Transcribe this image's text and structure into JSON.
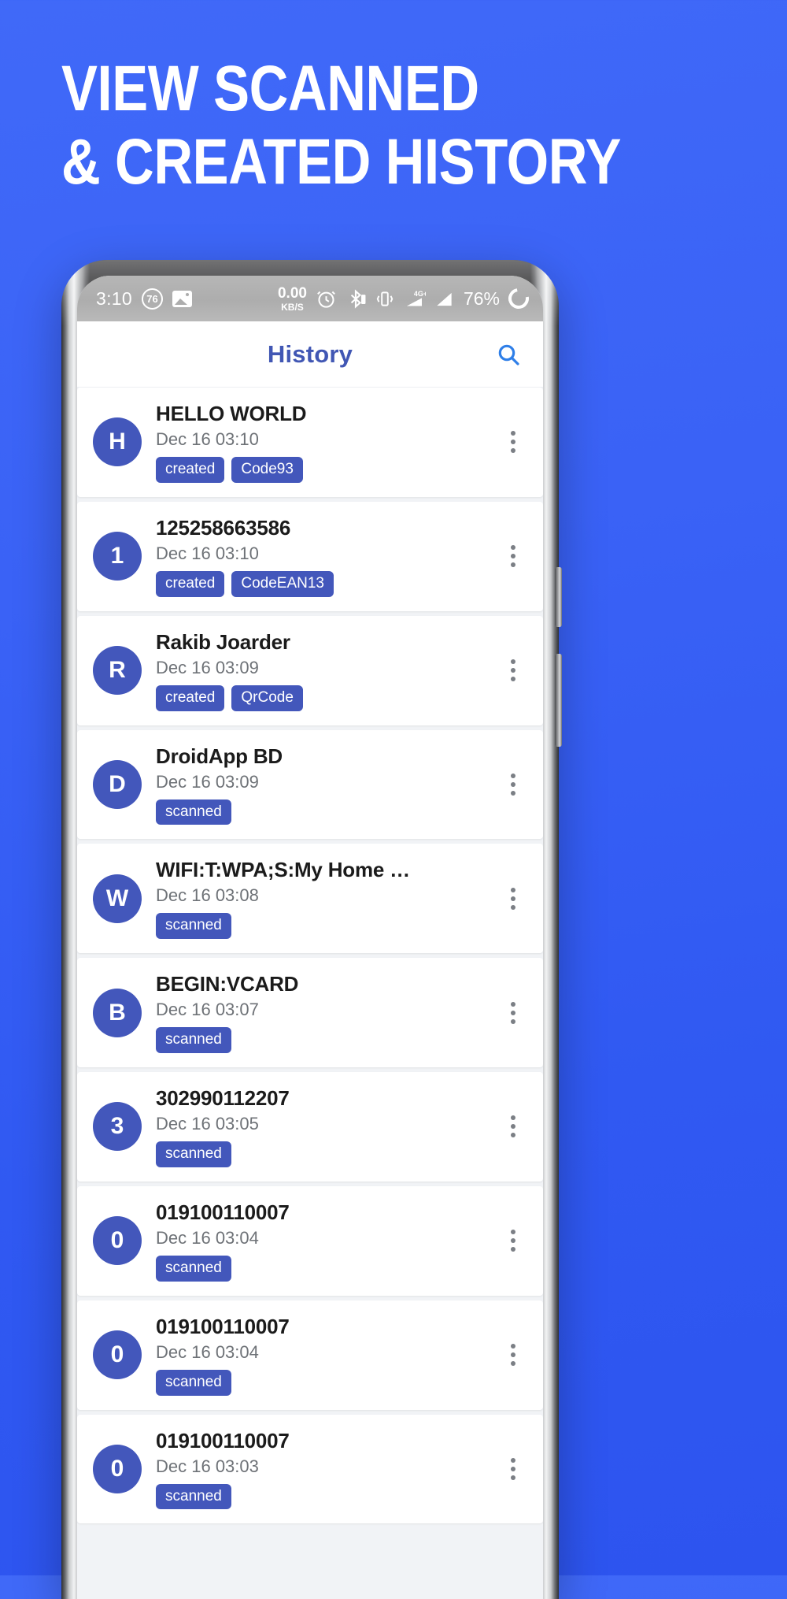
{
  "promo": {
    "line1": "VIEW SCANNED",
    "line2": "& CREATED HISTORY",
    "background_color": "#3a62f6",
    "text_color": "#ffffff"
  },
  "statusbar": {
    "time": "3:10",
    "notification_badge": "76",
    "image_icon": "image-icon",
    "network_speed_value": "0.00",
    "network_speed_unit": "KB/S",
    "alarm_icon": "alarm-clock-icon",
    "bluetooth_icon": "bluetooth-icon",
    "battery_small_icon": "battery-icon",
    "vibrate_icon": "vibrate-icon",
    "network_type": "4G+",
    "signal_icon_1": "signal-bars-icon",
    "signal_icon_2": "signal-bars-icon",
    "battery_percent": "76%",
    "battery_ring_icon": "battery-ring-icon"
  },
  "appbar": {
    "title": "History",
    "title_color": "#4157b4",
    "search_icon": "search-icon",
    "search_icon_color": "#2f7fe8"
  },
  "theme": {
    "accent": "#4357bb",
    "chip_bg": "#4357bb",
    "card_bg": "#ffffff",
    "list_bg": "#f1f3f6",
    "title_color": "#1b1b1b",
    "time_color": "#6e7277"
  },
  "list": {
    "items": [
      {
        "avatar": "H",
        "title": "HELLO WORLD",
        "time": "Dec 16 03:10",
        "chips": [
          "created",
          "Code93"
        ]
      },
      {
        "avatar": "1",
        "title": "125258663586",
        "time": "Dec 16 03:10",
        "chips": [
          "created",
          "CodeEAN13"
        ]
      },
      {
        "avatar": "R",
        "title": "Rakib Joarder",
        "time": "Dec 16 03:09",
        "chips": [
          "created",
          "QrCode"
        ]
      },
      {
        "avatar": "D",
        "title": "DroidApp BD",
        "time": "Dec 16 03:09",
        "chips": [
          "scanned"
        ]
      },
      {
        "avatar": "W",
        "title": "WIFI:T:WPA;S:My Home …",
        "time": "Dec 16 03:08",
        "chips": [
          "scanned"
        ]
      },
      {
        "avatar": "B",
        "title": "BEGIN:VCARD",
        "time": "Dec 16 03:07",
        "chips": [
          "scanned"
        ]
      },
      {
        "avatar": "3",
        "title": "302990112207",
        "time": "Dec 16 03:05",
        "chips": [
          "scanned"
        ]
      },
      {
        "avatar": "0",
        "title": "019100110007",
        "time": "Dec 16 03:04",
        "chips": [
          "scanned"
        ]
      },
      {
        "avatar": "0",
        "title": "019100110007",
        "time": "Dec 16 03:04",
        "chips": [
          "scanned"
        ]
      },
      {
        "avatar": "0",
        "title": "019100110007",
        "time": "Dec 16 03:03",
        "chips": [
          "scanned"
        ]
      }
    ]
  }
}
